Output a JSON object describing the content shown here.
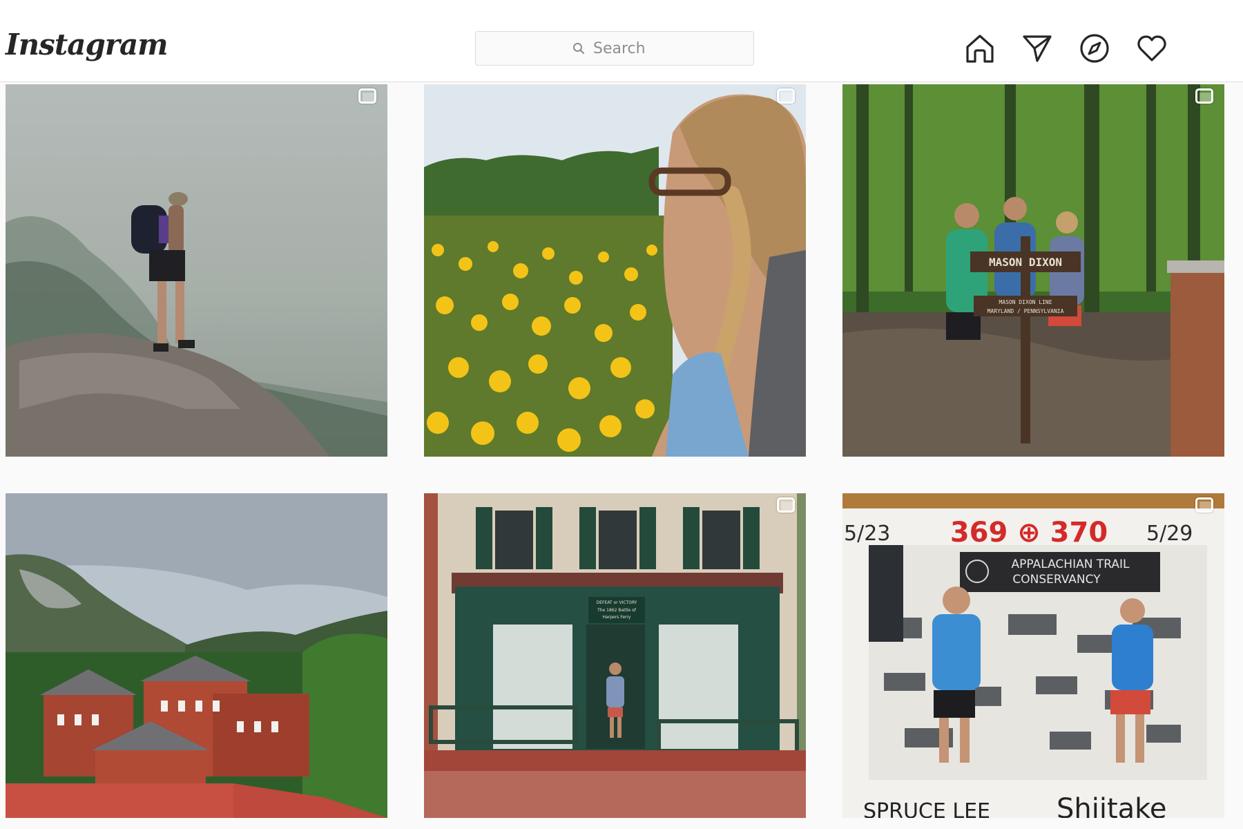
{
  "app": {
    "logo": "Instagram"
  },
  "search": {
    "placeholder": "Search",
    "icon": "search-icon"
  },
  "nav": [
    {
      "name": "home",
      "icon": "home-icon"
    },
    {
      "name": "direct",
      "icon": "paper-plane-icon"
    },
    {
      "name": "explore",
      "icon": "compass-icon"
    },
    {
      "name": "activity",
      "icon": "heart-icon"
    }
  ],
  "photos": [
    {
      "id": "foggy-cliff-hiker",
      "multi": true
    },
    {
      "id": "hiker-yellow-flowers",
      "multi": true
    },
    {
      "id": "mason-dixon-sign",
      "multi": true
    },
    {
      "id": "harpers-ferry-town",
      "multi": false
    },
    {
      "id": "historic-storefront",
      "multi": true
    },
    {
      "id": "appalachian-trail-conservancy-polaroid",
      "multi": true
    }
  ],
  "photo_text": {
    "sign_main": "MASON DIXON",
    "sign_line1": "MASON DIXON LINE",
    "sign_line2": "MARYLAND / PENNSYLVANIA",
    "store_sign_1": "DEFEAT or VICTORY",
    "store_sign_2": "The 1862 Battle of",
    "store_sign_3": "Harpers Ferry",
    "polaroid_date_left": "5/23",
    "polaroid_miles": "369 ⊕ 370",
    "polaroid_date_right": "5/29",
    "atc_line1": "APPALACHIAN TRAIL",
    "atc_line2": "CONSERVANCY",
    "caption_left": "SPRUCE LEE",
    "caption_right": "Shiitake"
  }
}
